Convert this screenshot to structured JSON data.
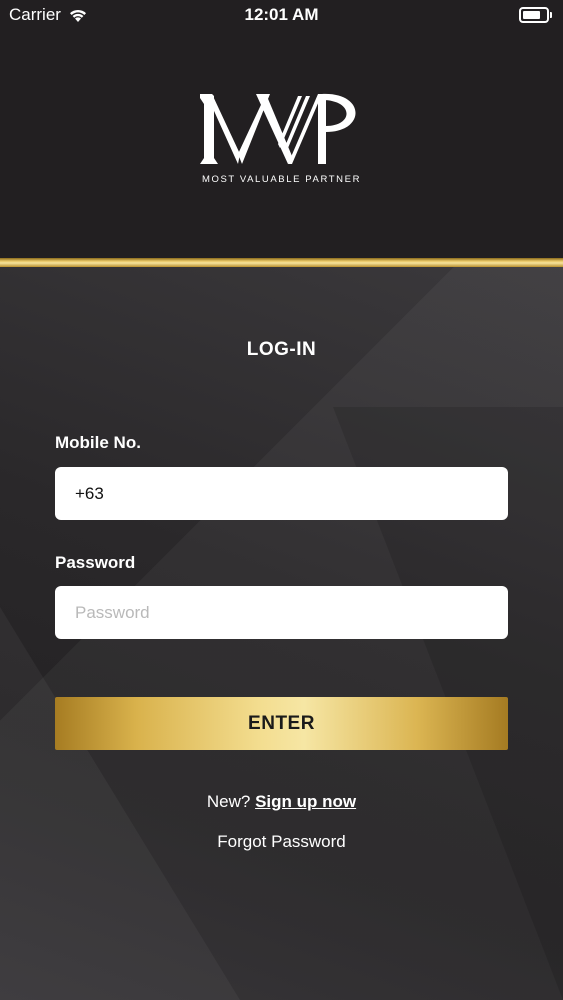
{
  "status_bar": {
    "carrier": "Carrier",
    "time": "12:01 AM",
    "battery_level": 0.75
  },
  "brand": {
    "logo_text": "MVP",
    "tagline": "MOST VALUABLE PARTNER",
    "gold_color": "#d9b24c",
    "background_color": "#221f21"
  },
  "login": {
    "title": "LOG-IN",
    "mobile_label": "Mobile No.",
    "mobile_value": "+63",
    "password_label": "Password",
    "password_placeholder": "Password",
    "enter_label": "ENTER",
    "new_prefix": "New?",
    "signup_label": "Sign up now",
    "forgot_label": "Forgot Password"
  }
}
